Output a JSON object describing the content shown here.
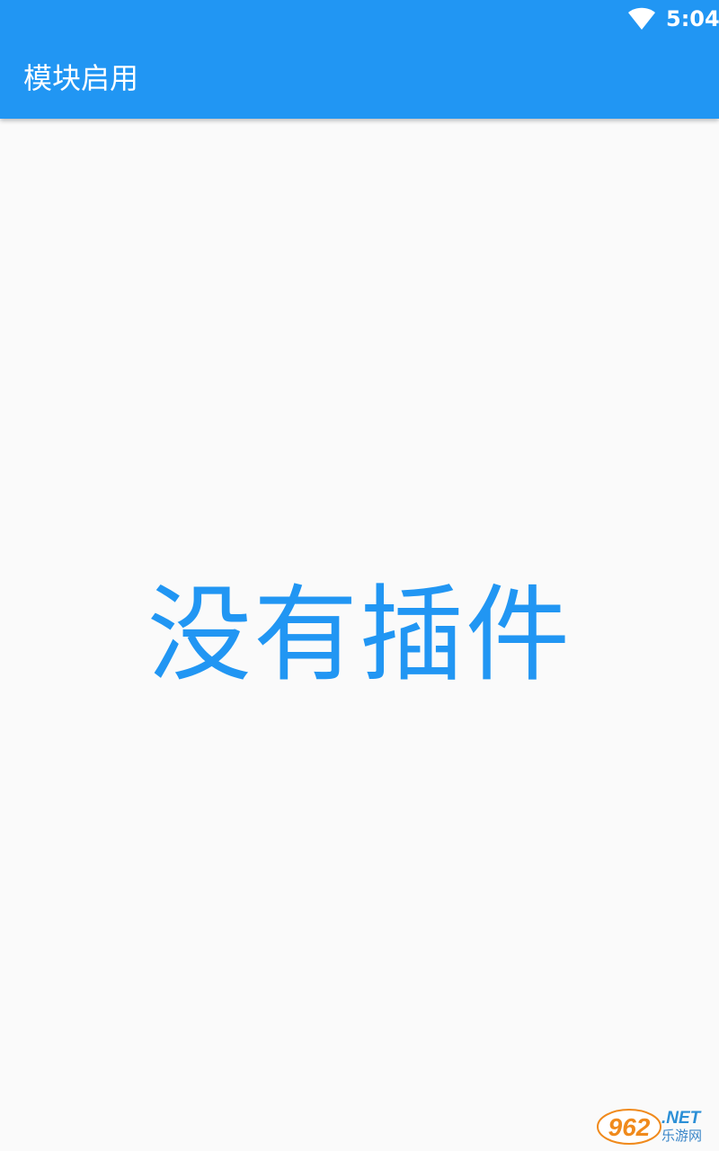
{
  "status_bar": {
    "time": "5:04",
    "wifi_icon": "wifi-icon"
  },
  "app_bar": {
    "title": "模块启用",
    "color": "#2196f3"
  },
  "main": {
    "empty_message": "没有插件",
    "text_color": "#2196f3"
  },
  "watermark": {
    "logo_text": "962",
    "suffix": ".NET",
    "subtitle": "乐游网"
  }
}
